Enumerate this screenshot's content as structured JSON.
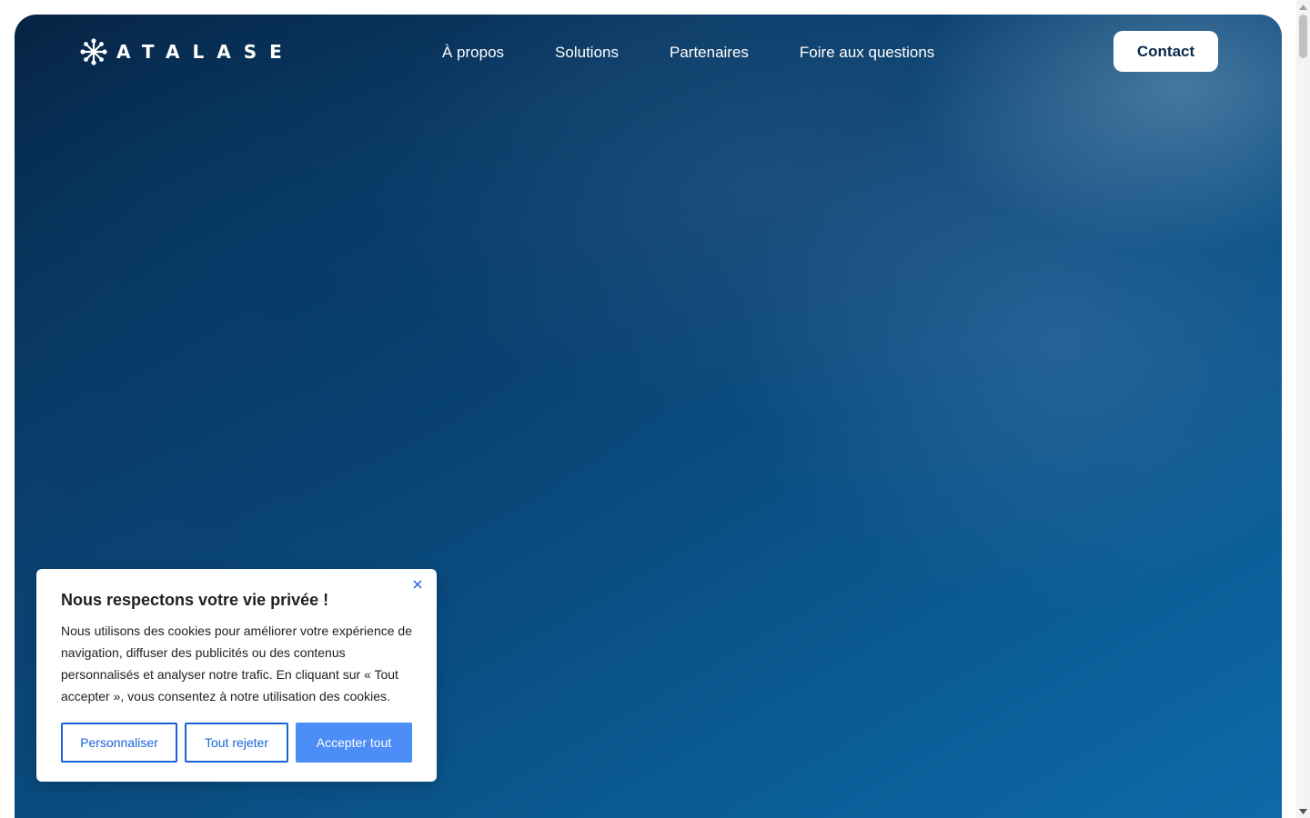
{
  "brand": {
    "name": "ATALASE",
    "logo_icon": "atalase-asterisk-logo-icon"
  },
  "nav": {
    "links": [
      {
        "label": "À propos"
      },
      {
        "label": "Solutions"
      },
      {
        "label": "Partenaires"
      },
      {
        "label": "Foire aux questions"
      }
    ],
    "contact_label": "Contact"
  },
  "cookie_banner": {
    "title": "Nous respectons votre vie privée !",
    "text": "Nous utilisons des cookies pour améliorer votre expérience de navigation, diffuser des publicités ou des contenus personnalisés et analyser notre trafic. En cliquant sur « Tout accepter », vous consentez à notre utilisation des cookies.",
    "buttons": {
      "customize": "Personnaliser",
      "reject_all": "Tout rejeter",
      "accept_all": "Accepter tout"
    },
    "close_icon": "close-icon"
  },
  "colors": {
    "hero_dark": "#062343",
    "hero_mid": "#0a4c80",
    "hero_light": "#0e6aa8",
    "contact_text": "#0b2a4a",
    "cookie_outline": "#1863dc",
    "cookie_accept": "#4d8df7"
  }
}
